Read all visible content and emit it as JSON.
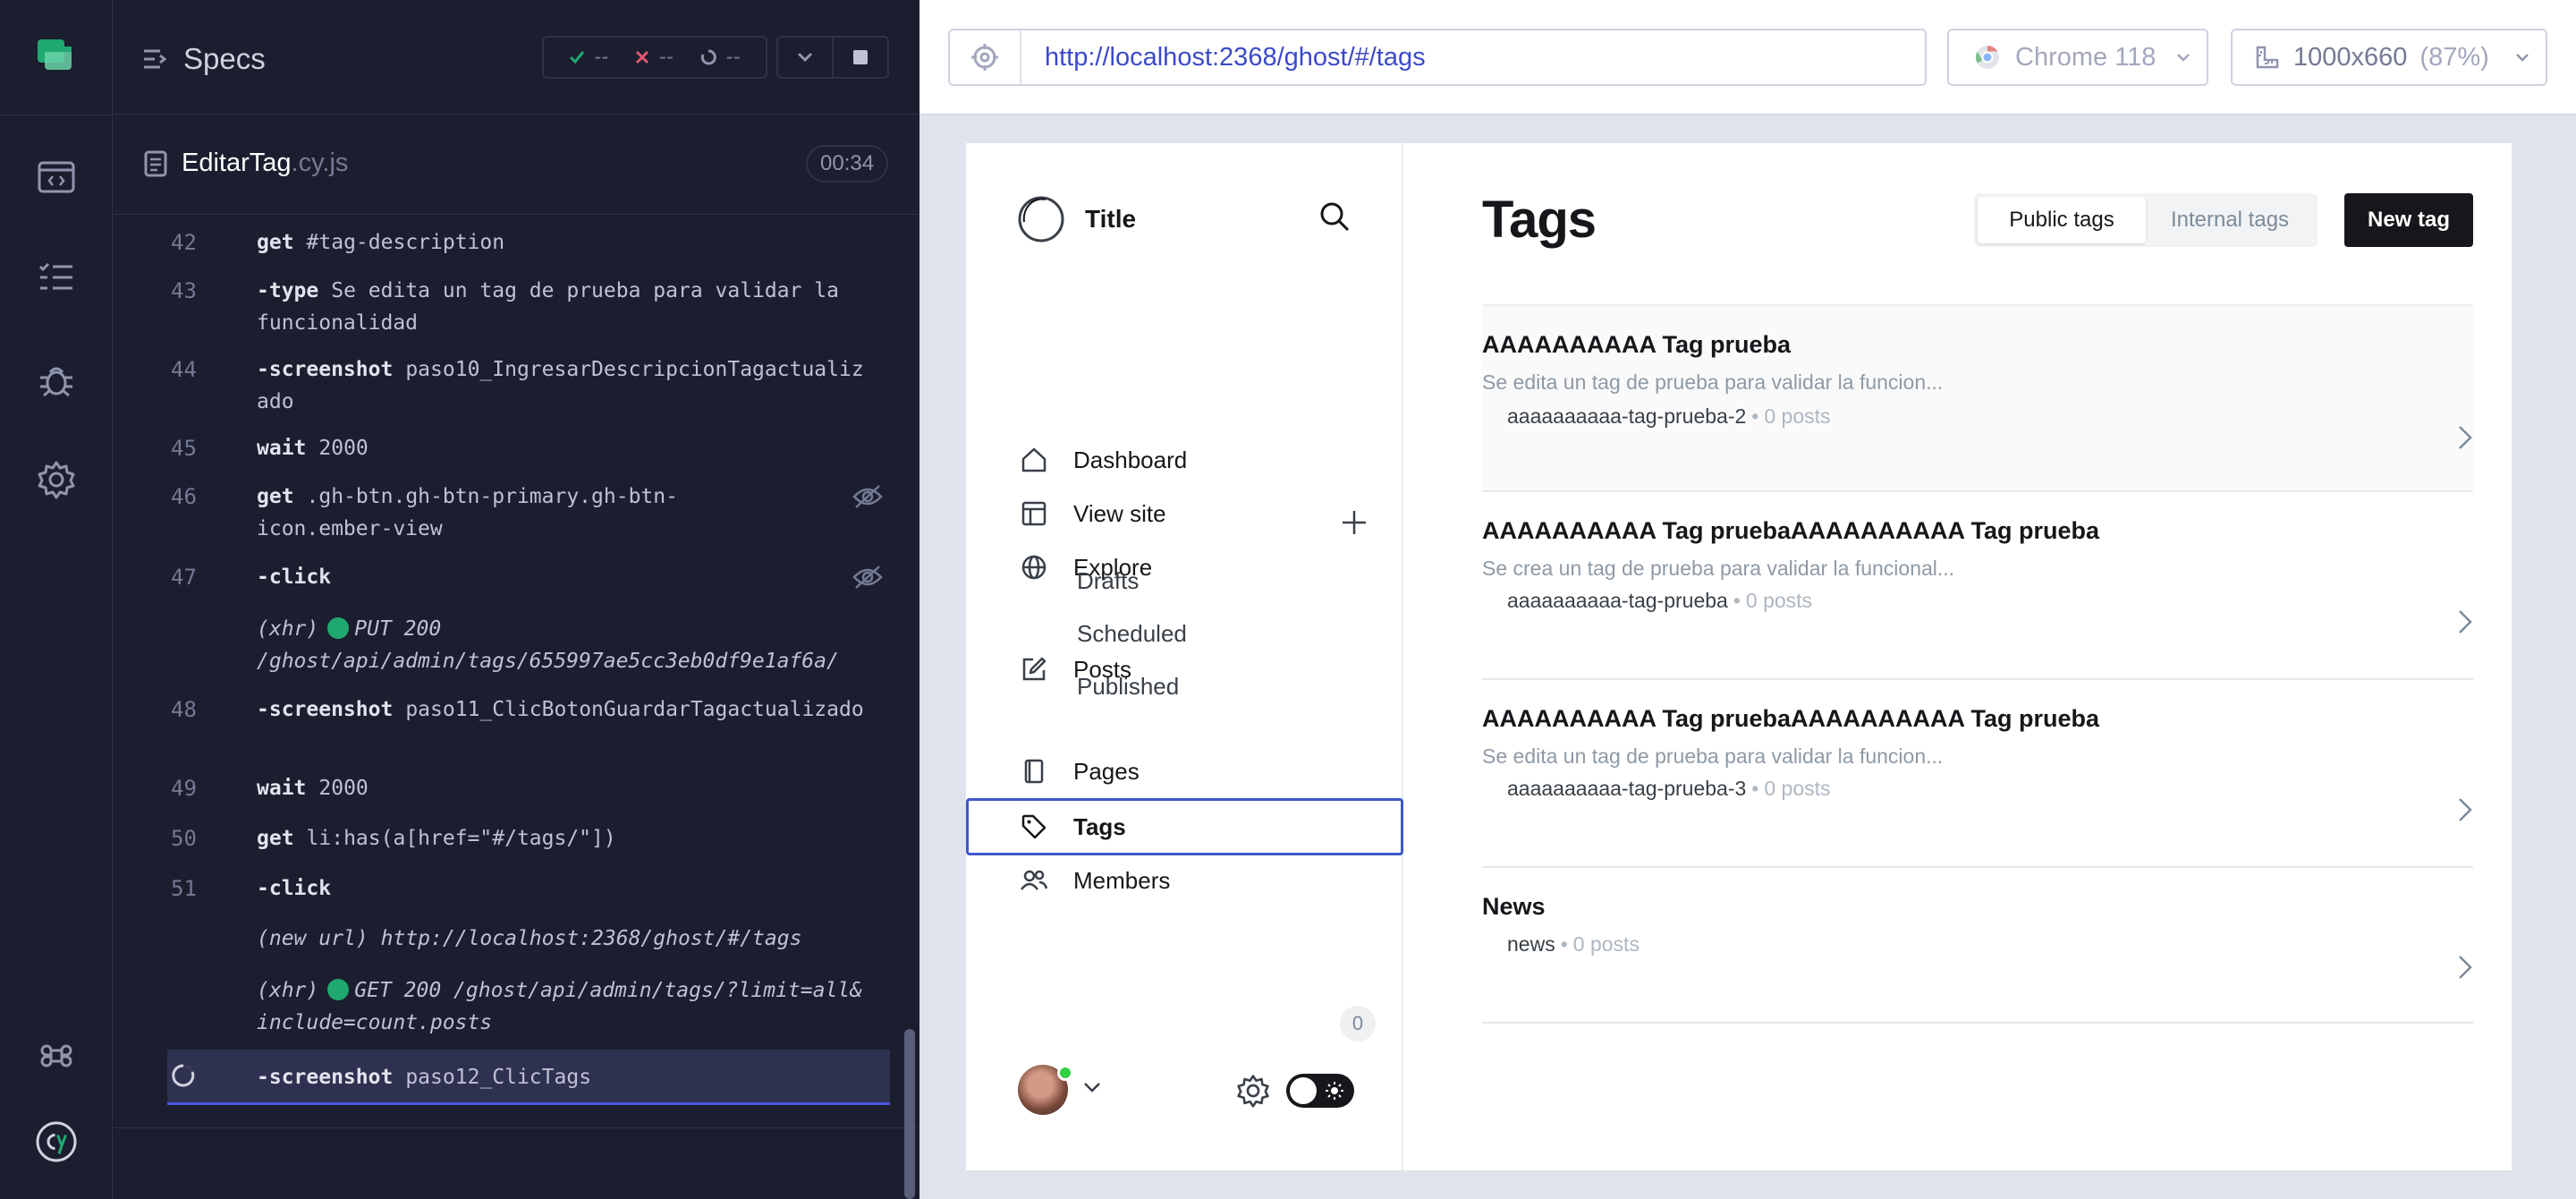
{
  "reporter": {
    "specs_label": "Specs",
    "stats": {
      "passed": "--",
      "failed": "--",
      "pending": "--"
    },
    "spec_file": {
      "name": "EditarTag",
      "ext": ".cy.js",
      "timer": "00:34"
    },
    "commands": [
      {
        "num": "42",
        "name": "get",
        "msg": "#tag-description"
      },
      {
        "num": "43",
        "name": "-type",
        "msg": "Se edita un tag de prueba para validar la funcionalidad"
      },
      {
        "num": "44",
        "name": "-screenshot",
        "msg": "paso10_IngresarDescripcionTagactualizado"
      },
      {
        "num": "45",
        "name": "wait",
        "msg": "2000"
      },
      {
        "num": "46",
        "name": "get",
        "msg": ".gh-btn.gh-btn-primary.gh-btn-icon.ember-view"
      },
      {
        "num": "47",
        "name": "-click",
        "msg": ""
      },
      {
        "num": "",
        "name": "(xhr)",
        "msg": "PUT 200 /ghost/api/admin/tags/655997ae5cc3eb0df9e1af6a/"
      },
      {
        "num": "48",
        "name": "-screenshot",
        "msg": "paso11_ClicBotonGuardarTagactualizado"
      },
      {
        "num": "49",
        "name": "wait",
        "msg": "2000"
      },
      {
        "num": "50",
        "name": "get",
        "msg": "li:has(a[href=\"#/tags/\"])"
      },
      {
        "num": "51",
        "name": "-click",
        "msg": ""
      },
      {
        "num": "",
        "name": "(new url)",
        "msg": "http://localhost:2368/ghost/#/tags"
      },
      {
        "num": "",
        "name": "(xhr)",
        "msg": "GET 200 /ghost/api/admin/tags/?limit=all&include=count.posts"
      },
      {
        "num": "",
        "name": "-screenshot",
        "msg": "paso12_ClicTags"
      }
    ]
  },
  "aut": {
    "url": "http://localhost:2368/ghost/#/tags",
    "browser": "Chrome 118",
    "viewport": "1000x660",
    "zoom": "(87%)"
  },
  "ghost": {
    "site_title": "Title",
    "nav": {
      "dashboard": "Dashboard",
      "view_site": "View site",
      "explore": "Explore",
      "posts": "Posts",
      "drafts": "Drafts",
      "scheduled": "Scheduled",
      "published": "Published",
      "pages": "Pages",
      "tags": "Tags",
      "members": "Members",
      "members_count": "0"
    },
    "page_title": "Tags",
    "segment": {
      "public": "Public tags",
      "internal": "Internal tags"
    },
    "new_tag": "New tag",
    "tags": [
      {
        "name": "AAAAAAAAAA Tag prueba",
        "description": "Se edita un tag de prueba para validar la funcion...",
        "slug": "aaaaaaaaaa-tag-prueba-2",
        "posts": "0 posts"
      },
      {
        "name": "AAAAAAAAAA Tag pruebaAAAAAAAAAA Tag prueba",
        "description": "Se crea un tag de prueba para validar la funcional...",
        "slug": "aaaaaaaaaa-tag-prueba",
        "posts": "0 posts"
      },
      {
        "name": "AAAAAAAAAA Tag pruebaAAAAAAAAAA Tag prueba",
        "description": "Se edita un tag de prueba para validar la funcion...",
        "slug": "aaaaaaaaaa-tag-prueba-3",
        "posts": "0 posts"
      },
      {
        "name": "News",
        "description": "",
        "slug": "news",
        "posts": "0 posts"
      }
    ]
  },
  "colors": {
    "cypress_bg": "#1b1e2e",
    "active_cmd": "#2f3151",
    "xhr_dot": "#1fa971",
    "url_blue": "#3c4ac9",
    "ghost_accent": "#3f58c7"
  }
}
